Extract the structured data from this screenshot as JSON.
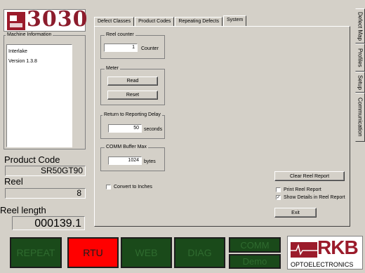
{
  "logo": {
    "number": "3030",
    "brand": "RKB"
  },
  "machine_info": {
    "label": "Machine Information",
    "lines": [
      "Interlake",
      "Version 1.3.8"
    ]
  },
  "product": {
    "label": "Product Code",
    "value": "SR50GT90"
  },
  "reel": {
    "label": "Reel",
    "value": "8"
  },
  "reel_length": {
    "label": "Reel length",
    "value": "000139.1"
  },
  "tabs": [
    "Defect Classes",
    "Product Codes",
    "Repeating Defects",
    "System"
  ],
  "active_tab": "System",
  "side_tabs": [
    "Defect Map",
    "Profiles",
    "Setup",
    "Communication"
  ],
  "reel_counter": {
    "label": "Reel counter",
    "value": "1",
    "unit": "Counter"
  },
  "meter": {
    "label": "Meter",
    "read": "Read",
    "reset": "Reset"
  },
  "delay": {
    "label": "Return to Reporting Delay",
    "value": "50",
    "unit": "seconds"
  },
  "comm_buffer": {
    "label": "COMM Buffer Max",
    "value": "1024",
    "unit": "bytes"
  },
  "convert": {
    "label": "Convert to Inches",
    "checked": false
  },
  "clear_report": "Clear Reel Report",
  "print_report": {
    "label": "Print Reel Report",
    "checked": false
  },
  "show_details": {
    "label": "Show Details in Reel Report",
    "checked": true
  },
  "exit": "Exit",
  "bottom_buttons": {
    "repeat": "REPEAT",
    "rtu": "RTU",
    "web": "WEB",
    "diag": "DIAG",
    "comm": "COMM",
    "demo": "Demo"
  },
  "rkb": {
    "letters": "RKB",
    "subtitle": "OPTOELECTRONICS"
  },
  "colors": {
    "panel_green": "#1a4a1a",
    "rtu_red": "#ff0000",
    "dim_text": "#2f6b2f",
    "bright_text": "#7fbf7f",
    "brand_red": "#9b1b2b"
  }
}
